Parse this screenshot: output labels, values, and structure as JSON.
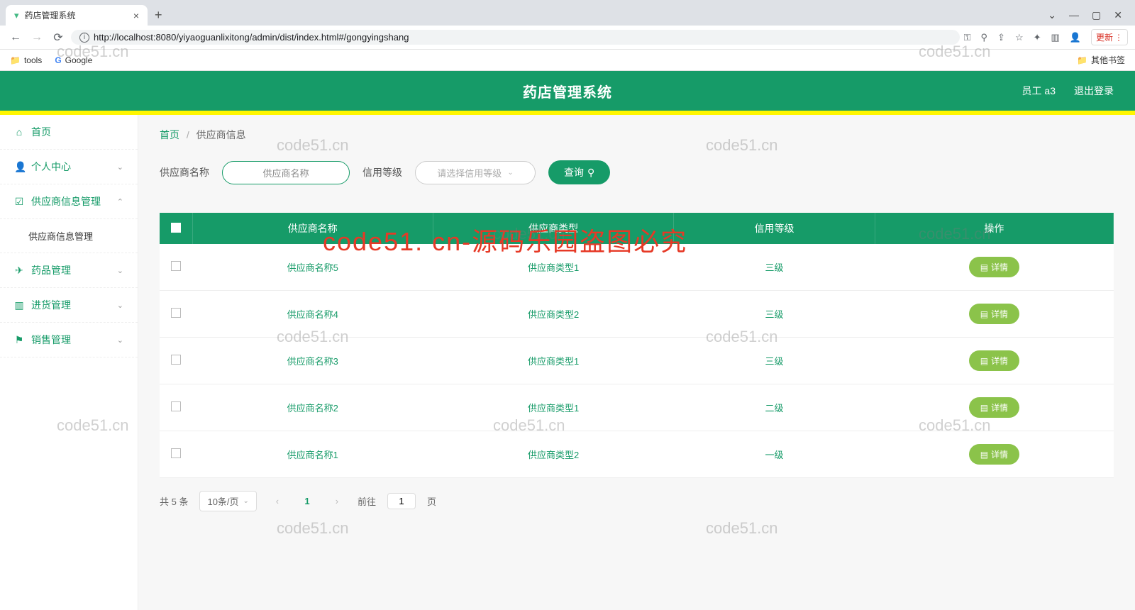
{
  "browser": {
    "tab_title": "药店管理系统",
    "url": "http://localhost:8080/yiyaoguanlixitong/admin/dist/index.html#/gongyingshang",
    "update_label": "更新",
    "bookmarks": {
      "tools": "tools",
      "google": "Google",
      "other": "其他书签"
    }
  },
  "header": {
    "title": "药店管理系统",
    "user": "员工 a3",
    "logout": "退出登录"
  },
  "sidebar": {
    "home": "首页",
    "personal": "个人中心",
    "supplier_mgmt": "供应商信息管理",
    "supplier_sub": "供应商信息管理",
    "drug_mgmt": "药品管理",
    "stock_mgmt": "进货管理",
    "sales_mgmt": "销售管理"
  },
  "breadcrumb": {
    "home": "首页",
    "current": "供应商信息"
  },
  "filter": {
    "name_label": "供应商名称",
    "name_placeholder": "供应商名称",
    "credit_label": "信用等级",
    "credit_placeholder": "请选择信用等级",
    "query_btn": "查询"
  },
  "table": {
    "headers": {
      "name": "供应商名称",
      "type": "供应商类型",
      "credit": "信用等级",
      "action": "操作"
    },
    "detail_btn": "详情",
    "rows": [
      {
        "name": "供应商名称5",
        "type": "供应商类型1",
        "credit": "三级"
      },
      {
        "name": "供应商名称4",
        "type": "供应商类型2",
        "credit": "三级"
      },
      {
        "name": "供应商名称3",
        "type": "供应商类型1",
        "credit": "三级"
      },
      {
        "name": "供应商名称2",
        "type": "供应商类型1",
        "credit": "二级"
      },
      {
        "name": "供应商名称1",
        "type": "供应商类型2",
        "credit": "一级"
      }
    ]
  },
  "pager": {
    "total": "共 5 条",
    "page_size": "10条/页",
    "current": "1",
    "jump_prefix": "前往",
    "jump_value": "1",
    "jump_suffix": "页"
  },
  "watermark": {
    "grey": "code51.cn",
    "red": "code51. cn-源码乐园盗图必究"
  }
}
